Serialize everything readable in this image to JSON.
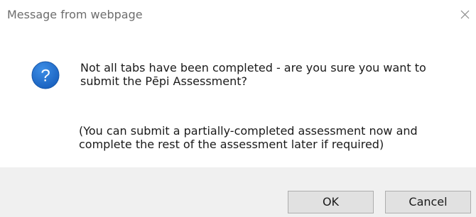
{
  "dialog": {
    "title": "Message from webpage",
    "close_icon": "close-icon",
    "icon": "question-icon",
    "message_primary": "Not all tabs have been completed - are you sure you want to submit the Pēpi Assessment?",
    "message_secondary": "(You can submit a partially-completed assessment now and complete the rest of the assessment later if required)",
    "buttons": {
      "ok_label": "OK",
      "cancel_label": "Cancel"
    }
  },
  "colors": {
    "icon_blue": "#1c6ec9",
    "footer_bg": "#f0f0f0",
    "button_bg": "#e1e1e1"
  }
}
